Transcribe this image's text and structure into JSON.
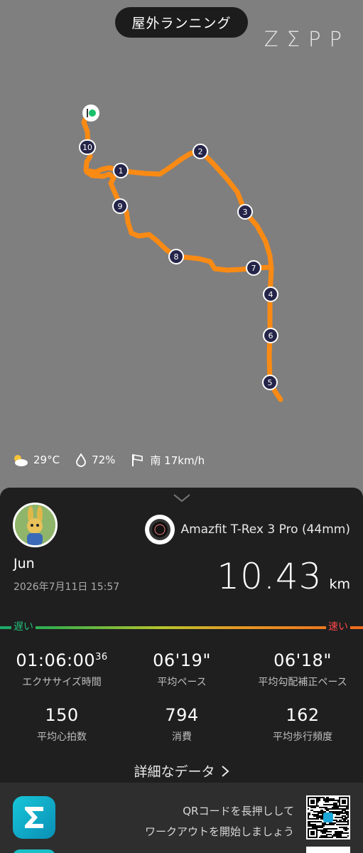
{
  "header": {
    "title": "屋外ランニング",
    "brand": "ZΣPP"
  },
  "map": {
    "route_color": "#f98a14",
    "markers": [
      "1",
      "2",
      "3",
      "4",
      "5",
      "6",
      "7",
      "8",
      "9",
      "10"
    ]
  },
  "weather": {
    "temperature": "29°C",
    "humidity": "72%",
    "wind": "南 17km/h"
  },
  "summary": {
    "user_name": "Jun",
    "date": "2026年7月11日 15:57",
    "device": "Amazfit T-Rex 3 Pro (44mm)",
    "distance_value": "10.43",
    "distance_unit": "km"
  },
  "pace_scale": {
    "slow_label": "遅い",
    "fast_label": "速い"
  },
  "stats": [
    {
      "value": "01:06:00",
      "sup": "36",
      "label": "エクササイズ時間"
    },
    {
      "value": "06'19\"",
      "sup": "",
      "label": "平均ペース"
    },
    {
      "value": "06'18\"",
      "sup": "",
      "label": "平均勾配補正ペース"
    },
    {
      "value": "150",
      "sup": "",
      "label": "平均心拍数"
    },
    {
      "value": "794",
      "sup": "",
      "label": "消費"
    },
    {
      "value": "162",
      "sup": "",
      "label": "平均歩行頻度"
    }
  ],
  "details_link": "詳細なデータ",
  "footer": {
    "qr_line1": "QRコードを長押しして",
    "qr_line2": "ワークアウトを開始しましょう"
  }
}
